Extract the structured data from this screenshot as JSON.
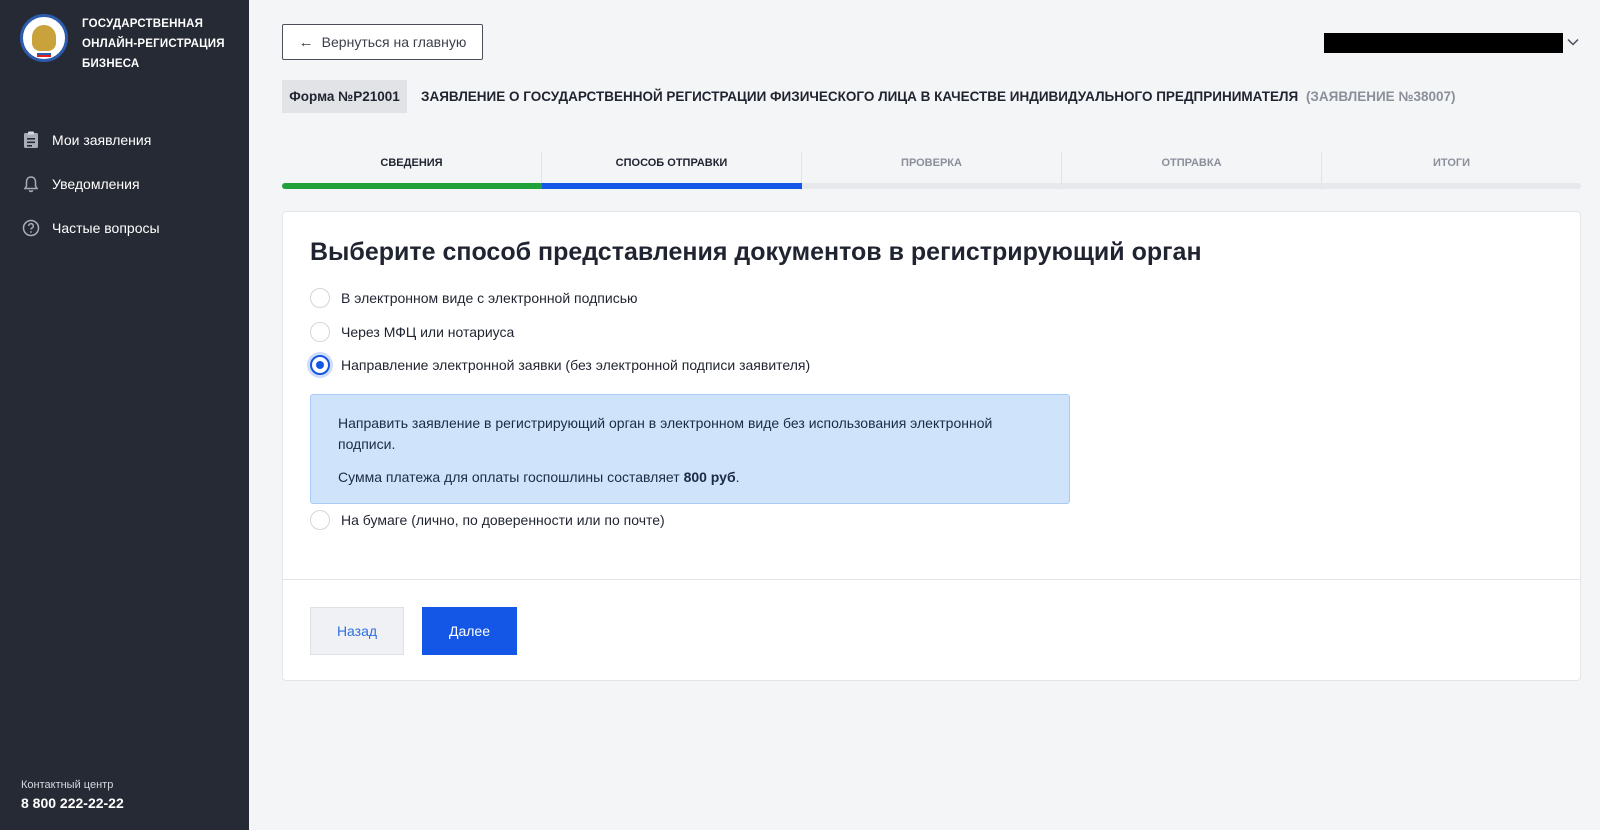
{
  "sidebar": {
    "brand_lines": [
      "ГОСУДАРСТВЕННАЯ",
      "ОНЛАЙН-РЕГИСТРАЦИЯ",
      "БИЗНЕСА"
    ],
    "items": [
      {
        "label": "Мои заявления",
        "icon": "clipboard-icon"
      },
      {
        "label": "Уведомления",
        "icon": "bell-icon"
      },
      {
        "label": "Частые вопросы",
        "icon": "question-circle-icon"
      }
    ],
    "contact_label": "Контактный центр",
    "contact_phone": "8 800 222-22-22"
  },
  "header": {
    "back_label": "Вернуться на главную",
    "form_tag": "Форма №Р21001",
    "form_title": "ЗАЯВЛЕНИЕ О ГОСУДАРСТВЕННОЙ РЕГИСТРАЦИИ ФИЗИЧЕСКОГО ЛИЦА В КАЧЕСТВЕ ИНДИВИДУАЛЬНОГО ПРЕДПРИНИМАТЕЛЯ",
    "form_number": "(ЗАЯВЛЕНИЕ №38007)"
  },
  "steps": [
    {
      "label": "СВЕДЕНИЯ",
      "state": "done"
    },
    {
      "label": "СПОСОБ ОТПРАВКИ",
      "state": "active"
    },
    {
      "label": "ПРОВЕРКА",
      "state": "pending"
    },
    {
      "label": "ОТПРАВКА",
      "state": "pending"
    },
    {
      "label": "ИТОГИ",
      "state": "pending"
    }
  ],
  "progress": {
    "completed_steps": 2,
    "total_steps": 5
  },
  "main": {
    "title": "Выберите способ представления документов в регистрирующий орган",
    "options": [
      {
        "label": "В электронном виде с электронной подписью",
        "checked": false
      },
      {
        "label": "Через МФЦ или нотариуса",
        "checked": false
      },
      {
        "label": "Направление электронной заявки (без электронной подписи заявителя)",
        "checked": true
      },
      {
        "label": "На бумаге (лично, по доверенности или по почте)",
        "checked": false
      }
    ],
    "info": {
      "text": "Направить заявление в регистрирующий орган в электронном виде без использования электронной подписи.",
      "fee_prefix": "Сумма платежа для оплаты госпошлины составляет ",
      "fee_amount": "800 руб",
      "fee_suffix": "."
    },
    "back_button": "Назад",
    "next_button": "Далее"
  },
  "colors": {
    "sidebar": "#262a35",
    "accent": "#1457e6",
    "done": "#22a03a",
    "info_bg": "#cfe3fb"
  }
}
